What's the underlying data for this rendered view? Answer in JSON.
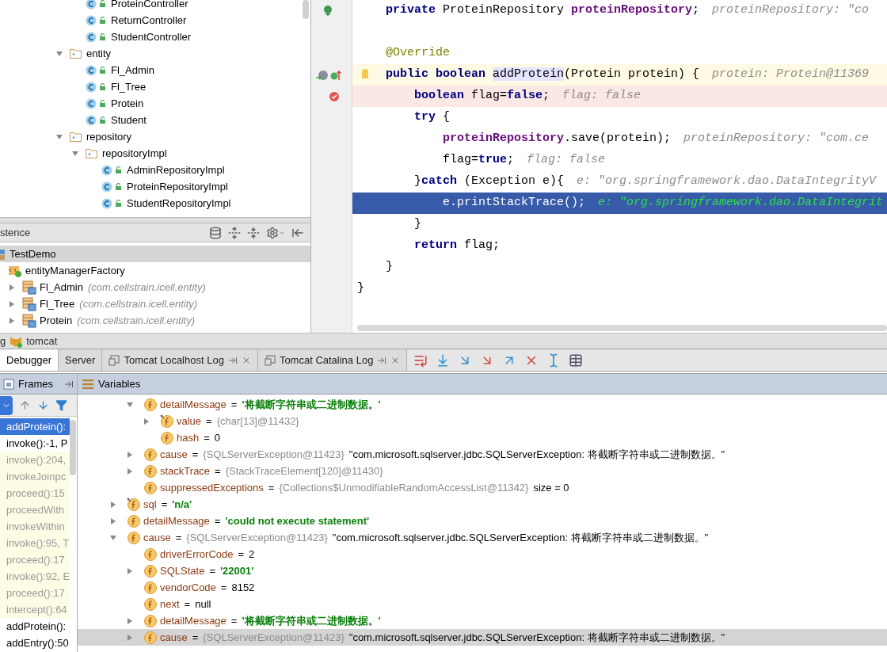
{
  "project_tree": {
    "items": [
      {
        "kind": "group",
        "children": [
          {
            "kind": "class",
            "label": "ProteinController"
          },
          {
            "kind": "class",
            "label": "ReturnController"
          },
          {
            "kind": "class",
            "label": "StudentController"
          }
        ]
      },
      {
        "kind": "package",
        "label": "entity",
        "expanded": true,
        "children": [
          {
            "kind": "class",
            "label": "Fl_Admin"
          },
          {
            "kind": "class",
            "label": "Fl_Tree"
          },
          {
            "kind": "class",
            "label": "Protein"
          },
          {
            "kind": "class",
            "label": "Student"
          }
        ]
      },
      {
        "kind": "package",
        "label": "repository",
        "expanded": true,
        "children": [
          {
            "kind": "package",
            "label": "repositoryImpl",
            "expanded": true,
            "children": [
              {
                "kind": "class",
                "label": "AdminRepositoryImpl"
              },
              {
                "kind": "class",
                "label": "ProteinRepositoryImpl"
              },
              {
                "kind": "class",
                "label": "StudentRepositoryImpl"
              }
            ]
          }
        ]
      }
    ]
  },
  "persistence": {
    "title": "stence",
    "items": [
      {
        "kind": "unit",
        "label": "TestDemo",
        "selected": true,
        "children": [
          {
            "kind": "factory",
            "label": "entityManagerFactory",
            "selected": false
          },
          {
            "kind": "entity",
            "label": "Fl_Admin",
            "package": "(com.cellstrain.icell.entity)",
            "selected": false,
            "expanded": false
          },
          {
            "kind": "entity",
            "label": "Fl_Tree",
            "package": "(com.cellstrain.icell.entity)",
            "selected": false,
            "expanded": false
          },
          {
            "kind": "entity",
            "label": "Protein",
            "package": "(com.cellstrain.icell.entity)",
            "selected": false,
            "expanded": false
          }
        ]
      }
    ]
  },
  "editor": {
    "lines": [
      {
        "kind": "bean",
        "tokens": [
          {
            "kind": "keyword",
            "text": "private"
          },
          {
            "kind": "plain",
            "text": " ProteinRepository "
          },
          {
            "kind": "field",
            "text": "proteinRepository"
          },
          {
            "kind": "plain",
            "text": ";"
          }
        ],
        "hint": "proteinRepository: \"co"
      },
      {
        "kind": "plain"
      },
      {
        "kind": "plain",
        "tokens": [
          {
            "kind": "annotation",
            "text": "@Override"
          }
        ]
      },
      {
        "kind": "method",
        "tokens": [
          {
            "kind": "keyword",
            "text": "public boolean"
          },
          {
            "kind": "usage",
            "text": "addProtein",
            "gap_before": true
          },
          {
            "kind": "plain",
            "text": "(Protein protein) {"
          }
        ],
        "hint": "protein: Protein@11369"
      },
      {
        "kind": "breakpoint",
        "tokens": [
          {
            "kind": "keyword",
            "text": "boolean"
          },
          {
            "kind": "plain",
            "text": " flag="
          },
          {
            "kind": "keyword",
            "text": "false"
          },
          {
            "kind": "plain",
            "text": ";"
          }
        ],
        "hint": "flag: false"
      },
      {
        "kind": "plain",
        "tokens": [
          {
            "kind": "keyword",
            "text": "try"
          },
          {
            "kind": "plain",
            "text": " {"
          }
        ]
      },
      {
        "kind": "plain",
        "tokens": [
          {
            "kind": "field",
            "text": "proteinRepository"
          },
          {
            "kind": "plain",
            "text": ".save(protein);"
          }
        ],
        "hint": "proteinRepository: \"com.ce"
      },
      {
        "kind": "plain",
        "tokens": [
          {
            "kind": "plain",
            "text": "flag="
          },
          {
            "kind": "keyword",
            "text": "true"
          },
          {
            "kind": "plain",
            "text": ";"
          }
        ],
        "hint": "flag: false"
      },
      {
        "kind": "plain",
        "tokens": [
          {
            "kind": "plain",
            "text": "}"
          },
          {
            "kind": "keyword",
            "text": "catch"
          },
          {
            "kind": "plain",
            "text": " (Exception e){"
          }
        ],
        "hint": "e: \"org.springframework.dao.DataIntegrityV"
      },
      {
        "kind": "current",
        "tokens": [
          {
            "kind": "plain",
            "text": "e.printStackTrace();"
          }
        ],
        "hint": "e: \"org.springframework.dao.DataIntegrit"
      },
      {
        "kind": "plain",
        "tokens": [
          {
            "kind": "plain",
            "text": "}"
          }
        ]
      },
      {
        "kind": "plain",
        "tokens": [
          {
            "kind": "keyword",
            "text": "return"
          },
          {
            "kind": "plain",
            "text": " flag;"
          }
        ]
      },
      {
        "kind": "plain",
        "tokens": [
          {
            "kind": "plain",
            "text": "}"
          }
        ]
      },
      {
        "kind": "plain",
        "tokens": [
          {
            "kind": "plain",
            "text": "}"
          }
        ]
      }
    ]
  },
  "run_panel": {
    "title_prefix": "g",
    "config": "tomcat"
  },
  "tabs": [
    {
      "label": "Debugger",
      "selected": true,
      "kind": "plain"
    },
    {
      "label": "Server",
      "selected": false,
      "kind": "plain"
    },
    {
      "label": "Tomcat Localhost Log",
      "selected": false,
      "kind": "log"
    },
    {
      "label": "Tomcat Catalina Log",
      "selected": false,
      "kind": "log"
    }
  ],
  "frames": {
    "title": "Frames",
    "items": [
      {
        "label": "addProtein():",
        "kind": "app",
        "selected": true
      },
      {
        "label": "invoke():-1, P",
        "kind": "app",
        "selected": false
      },
      {
        "label": "invoke():204,",
        "kind": "library",
        "selected": false
      },
      {
        "label": "invokeJoinpc",
        "kind": "library",
        "selected": false
      },
      {
        "label": "proceed():15",
        "kind": "library",
        "selected": false
      },
      {
        "label": "proceedWith",
        "kind": "library",
        "selected": false
      },
      {
        "label": "invokeWithin",
        "kind": "library",
        "selected": false
      },
      {
        "label": "invoke():95, T",
        "kind": "library",
        "selected": false
      },
      {
        "label": "proceed():17",
        "kind": "library",
        "selected": false
      },
      {
        "label": "invoke():92, E",
        "kind": "library",
        "selected": false
      },
      {
        "label": "proceed():17",
        "kind": "library",
        "selected": false
      },
      {
        "label": "intercept():64",
        "kind": "library",
        "selected": false
      },
      {
        "label": "addProtein():",
        "kind": "app",
        "selected": false
      },
      {
        "label": "addEntry():50",
        "kind": "app",
        "selected": false
      }
    ]
  },
  "variables": {
    "title": "Variables",
    "items": [
      {
        "kind": "group",
        "children": [
          {
            "kind": "string",
            "name": "detailMessage",
            "sep": "=",
            "expanded": true,
            "final": false,
            "selected": false,
            "value": "'将截断字符串或二进制数据。'",
            "children": [
              {
                "name": "value",
                "sep": "=",
                "expanded": false,
                "final": true,
                "selected": false,
                "ref": "{char[13]@11432}"
              },
              {
                "kind": "plain",
                "name": "hash",
                "sep": "=",
                "final": false,
                "selected": false,
                "value": "0"
              }
            ]
          },
          {
            "kind": "plain",
            "name": "cause",
            "sep": "=",
            "expanded": false,
            "final": false,
            "selected": false,
            "ref": "{SQLServerException@11423}",
            "value": "\"com.microsoft.sqlserver.jdbc.SQLServerException: 将截断字符串或二进制数据。\""
          },
          {
            "name": "stackTrace",
            "sep": "=",
            "expanded": false,
            "final": false,
            "selected": false,
            "ref": "{StackTraceElement[120]@11430}"
          },
          {
            "kind": "plain",
            "name": "suppressedExceptions",
            "sep": "=",
            "final": false,
            "selected": false,
            "ref": "{Collections$UnmodifiableRandomAccessList@11342}",
            "value": "size = 0"
          }
        ]
      },
      {
        "kind": "string",
        "name": "sql",
        "sep": "=",
        "expanded": false,
        "final": true,
        "selected": false,
        "value": "'n/a'"
      },
      {
        "kind": "string",
        "name": "detailMessage",
        "sep": "=",
        "expanded": false,
        "final": false,
        "selected": false,
        "value": "'could not execute statement'"
      },
      {
        "kind": "plain",
        "name": "cause",
        "sep": "=",
        "expanded": true,
        "final": false,
        "selected": false,
        "ref": "{SQLServerException@11423}",
        "value": "\"com.microsoft.sqlserver.jdbc.SQLServerException: 将截断字符串或二进制数据。\"",
        "children": [
          {
            "kind": "plain",
            "name": "driverErrorCode",
            "sep": "=",
            "final": false,
            "selected": false,
            "value": "2"
          },
          {
            "kind": "string",
            "name": "SQLState",
            "sep": "=",
            "expanded": false,
            "final": false,
            "selected": false,
            "value": "'22001'"
          },
          {
            "kind": "plain",
            "name": "vendorCode",
            "sep": "=",
            "final": false,
            "selected": false,
            "value": "8152"
          },
          {
            "kind": "plain",
            "name": "next",
            "sep": "=",
            "final": false,
            "selected": false,
            "value": "null"
          },
          {
            "kind": "string",
            "name": "detailMessage",
            "sep": "=",
            "expanded": false,
            "final": false,
            "selected": false,
            "value": "'将截断字符串或二进制数据。'"
          },
          {
            "kind": "plain",
            "name": "cause",
            "sep": "=",
            "expanded": false,
            "final": false,
            "selected": true,
            "ref": "{SQLServerException@11423}",
            "value": "\"com.microsoft.sqlserver.jdbc.SQLServerException: 将截断字符串或二进制数据。\""
          }
        ]
      }
    ]
  }
}
